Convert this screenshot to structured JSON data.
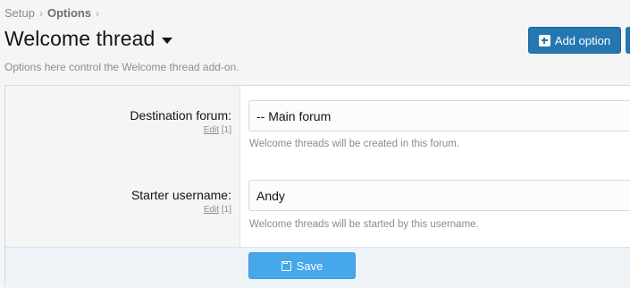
{
  "breadcrumb": {
    "items": [
      "Setup",
      "Options"
    ],
    "separator": "›"
  },
  "header": {
    "title": "Welcome thread",
    "description": "Options here control the Welcome thread add-on.",
    "add_option_label": "Add option"
  },
  "form": {
    "rows": [
      {
        "label": "Destination forum:",
        "edit_link": "Edit",
        "edit_count": "[1]",
        "value": "-- Main forum",
        "hint": "Welcome threads will be created in this forum."
      },
      {
        "label": "Starter username:",
        "edit_link": "Edit",
        "edit_count": "[1]",
        "value": "Andy",
        "hint": "Welcome threads will be started by this username."
      }
    ],
    "save_label": "Save"
  },
  "colors": {
    "primary_button": "#2577b1",
    "save_button": "#47a7eb",
    "submit_row_bg": "#eef3f8"
  },
  "icons": {
    "add_option": "plus-square-icon",
    "title_dropdown": "caret-down-icon",
    "save": "save-icon"
  }
}
